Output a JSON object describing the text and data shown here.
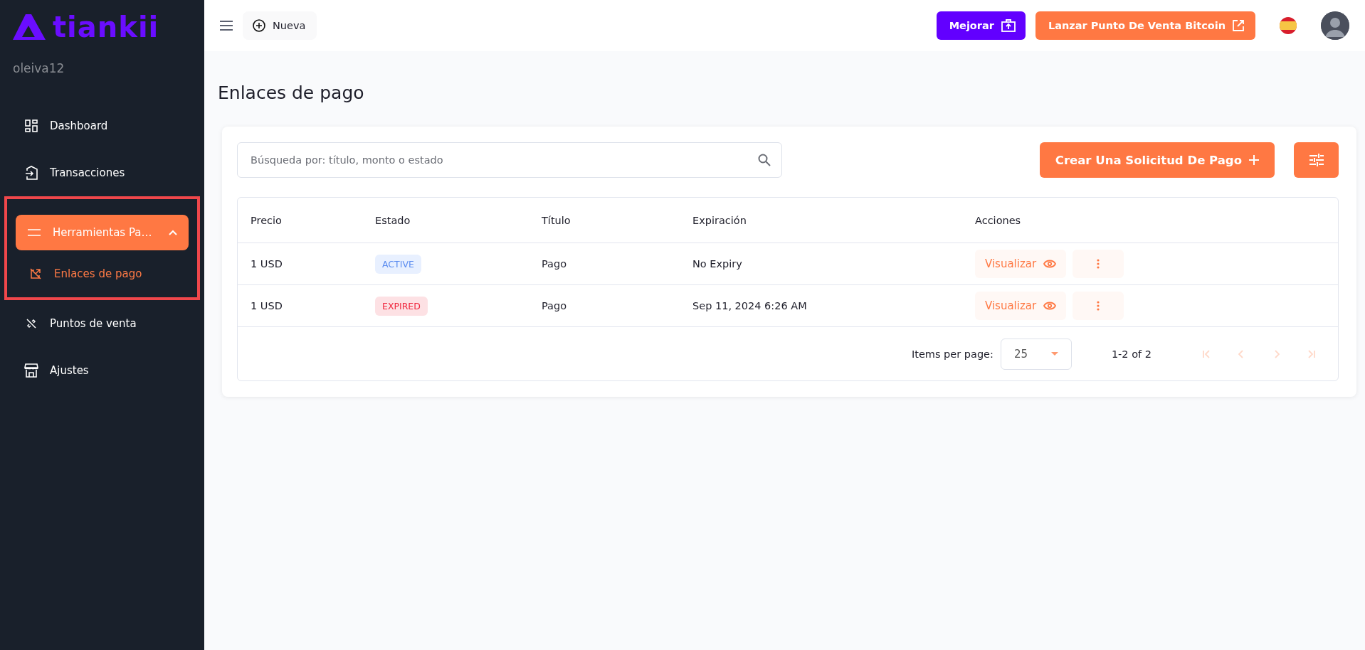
{
  "sidebar": {
    "logo": "tiankii",
    "username": "oleiva12",
    "items": [
      {
        "label": "Dashboard",
        "selected": false
      },
      {
        "label": "Transacciones",
        "selected": false
      },
      {
        "label": "Herramientas Pa…",
        "selected": true,
        "expanded": true,
        "highlighted": true,
        "children": [
          {
            "label": "Enlaces de pago",
            "selected": true
          }
        ]
      },
      {
        "label": "Puntos de venta",
        "selected": false
      },
      {
        "label": "Ajustes",
        "selected": false
      }
    ]
  },
  "topbar": {
    "new_button": "Nueva",
    "upgrade_button": "Mejorar",
    "launch_button": "Lanzar Punto De Venta Bitcoin"
  },
  "page": {
    "title": "Enlaces de pago"
  },
  "search": {
    "placeholder": "Búsqueda por: título, monto o estado"
  },
  "create_button": "Crear Una Solicitud De Pago",
  "table": {
    "columns": [
      "Precio",
      "Estado",
      "Título",
      "Expiración",
      "Acciones"
    ],
    "rows": [
      {
        "price": "1 USD",
        "status": {
          "label": "ACTIVE",
          "kind": "active"
        },
        "title": "Pago",
        "expiration": "No Expiry",
        "view_button": "Visualizar"
      },
      {
        "price": "1 USD",
        "status": {
          "label": "EXPIRED",
          "kind": "expired"
        },
        "title": "Pago",
        "expiration": "Sep 11, 2024 6:26 AM",
        "view_button": "Visualizar"
      }
    ]
  },
  "pagination": {
    "label": "Items per page:",
    "page_size": "25",
    "range": "1-2 of 2",
    "buttons": [
      {
        "kind": "first",
        "disabled": true
      },
      {
        "kind": "prev",
        "disabled": true
      },
      {
        "kind": "next",
        "disabled": true
      },
      {
        "kind": "last",
        "disabled": true
      }
    ]
  }
}
